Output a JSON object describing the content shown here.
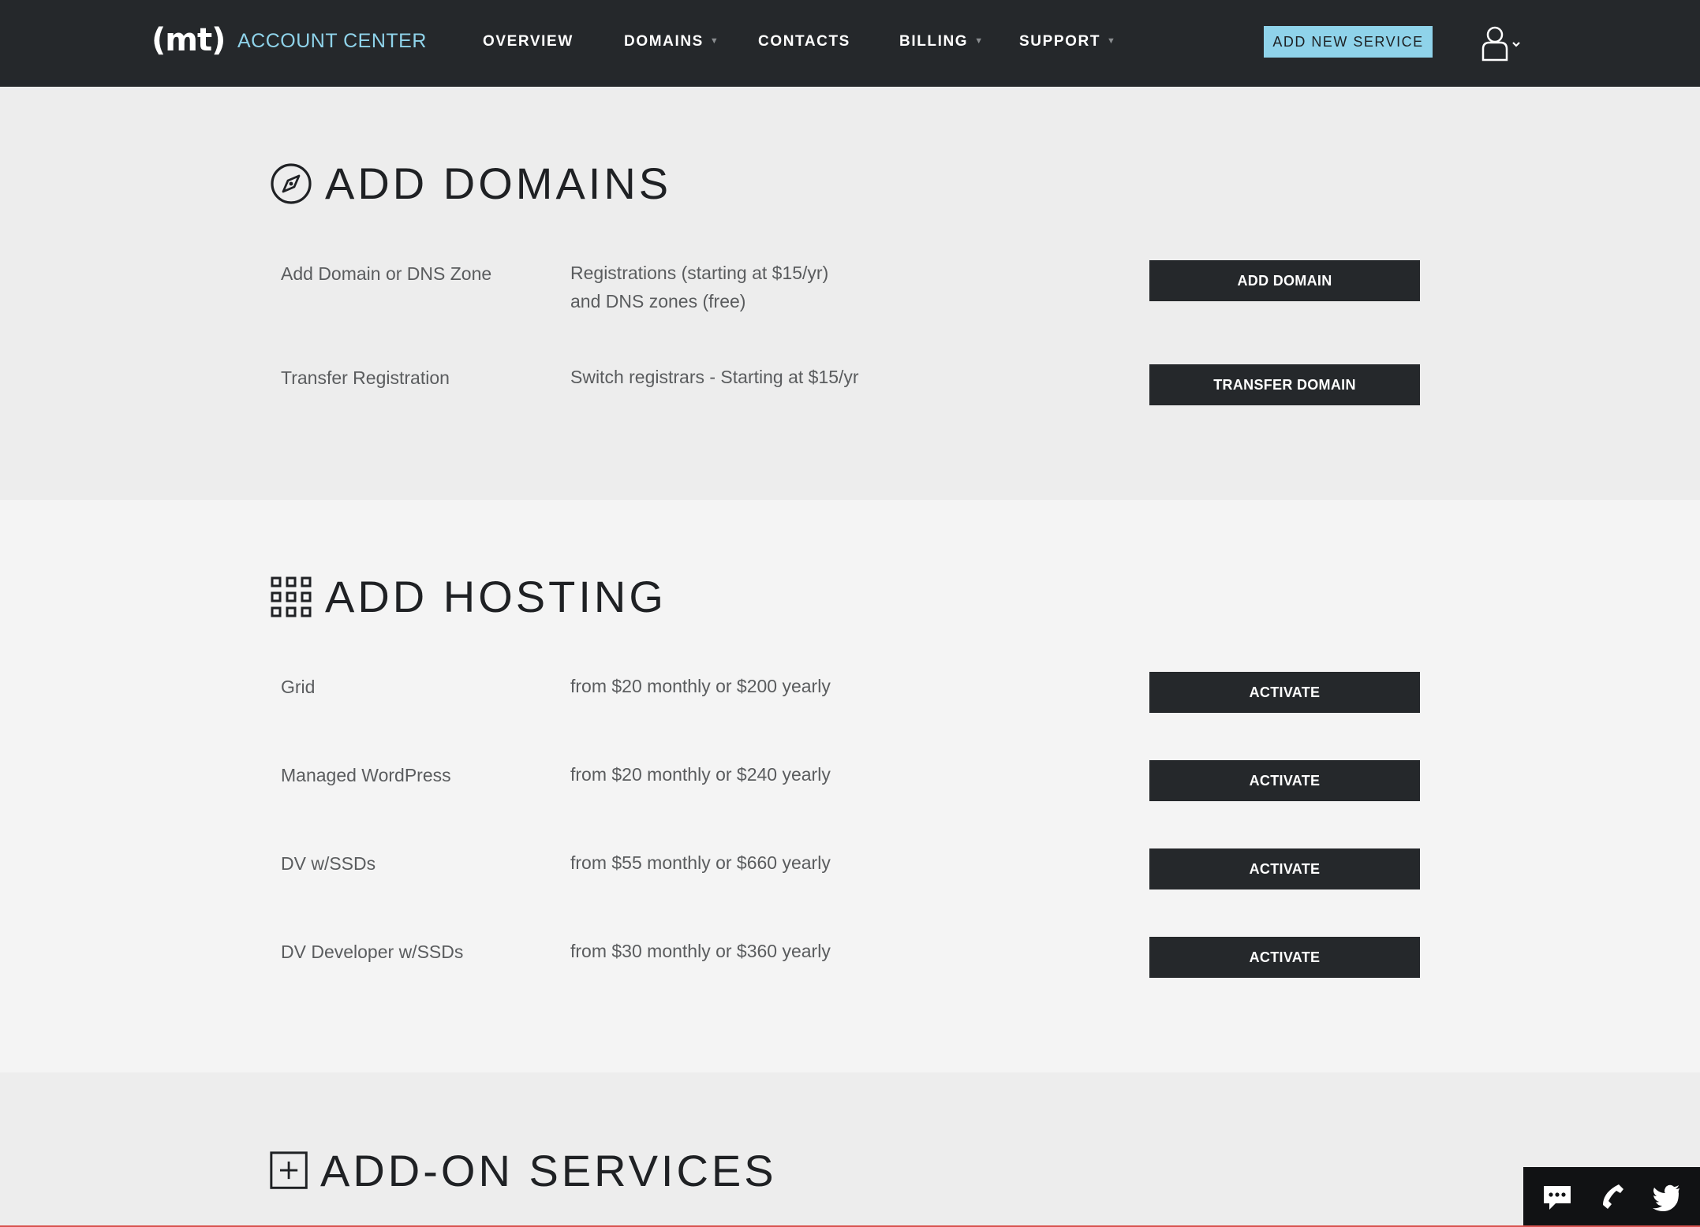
{
  "header": {
    "logo": "(mt)",
    "app_title": "ACCOUNT CENTER",
    "nav": [
      {
        "label": "OVERVIEW",
        "has_dropdown": false
      },
      {
        "label": "DOMAINS",
        "has_dropdown": true
      },
      {
        "label": "CONTACTS",
        "has_dropdown": false
      },
      {
        "label": "BILLING",
        "has_dropdown": true
      },
      {
        "label": "SUPPORT",
        "has_dropdown": true
      }
    ],
    "caret": "▼",
    "add_service_label": "ADD NEW SERVICE",
    "user_icon": "user-icon",
    "accent_color": "#8fd3ea",
    "bar_color": "#25282b"
  },
  "domains": {
    "title": "ADD DOMAINS",
    "icon": "compass-icon",
    "rows": [
      {
        "name": "Add Domain or DNS Zone",
        "desc_line1": "Registrations (starting at $15/yr)",
        "desc_line2": "and DNS zones (free)",
        "button": "ADD DOMAIN"
      },
      {
        "name": "Transfer Registration",
        "desc_line1": "Switch registrars - Starting at $15/yr",
        "button": "TRANSFER DOMAIN"
      }
    ]
  },
  "hosting": {
    "title": "ADD HOSTING",
    "icon": "grid-icon",
    "rows": [
      {
        "name": "Grid",
        "desc": "from $20 monthly or $200 yearly",
        "button": "ACTIVATE"
      },
      {
        "name": "Managed WordPress",
        "desc": "from $20 monthly or $240 yearly",
        "button": "ACTIVATE"
      },
      {
        "name": "DV w/SSDs",
        "desc": "from $55 monthly or $660 yearly",
        "button": "ACTIVATE"
      },
      {
        "name": "DV Developer w/SSDs",
        "desc": "from $30 monthly or $360 yearly",
        "button": "ACTIVATE"
      }
    ]
  },
  "addons": {
    "title": "ADD-ON SERVICES",
    "icon": "plus-box-icon"
  },
  "contact_bar": {
    "icons": [
      "chat-icon",
      "phone-icon",
      "twitter-icon"
    ]
  }
}
